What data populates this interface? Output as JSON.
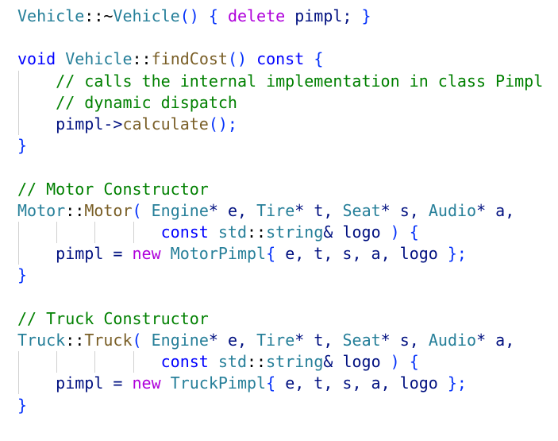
{
  "code_lines": [
    [
      {
        "text": "Vehicle",
        "color": "#267f99"
      },
      {
        "text": "::~",
        "color": "#000000"
      },
      {
        "text": "Vehicle",
        "color": "#267f99"
      },
      {
        "text": "() { ",
        "color": "#0431fa"
      },
      {
        "text": "delete",
        "color": "#af00db"
      },
      {
        "text": " pimpl; ",
        "color": "#001080"
      },
      {
        "text": "}",
        "color": "#0431fa"
      }
    ],
    [],
    [
      {
        "text": "void",
        "color": "#0000ff"
      },
      {
        "text": " ",
        "color": "#000000"
      },
      {
        "text": "Vehicle",
        "color": "#267f99"
      },
      {
        "text": "::",
        "color": "#000000"
      },
      {
        "text": "findCost",
        "color": "#795e26"
      },
      {
        "text": "() ",
        "color": "#0431fa"
      },
      {
        "text": "const",
        "color": "#0000ff"
      },
      {
        "text": " {",
        "color": "#0431fa"
      }
    ],
    [
      {
        "text": "    // calls the internal implementation in class Pimpl",
        "color": "#008000"
      }
    ],
    [
      {
        "text": "    // dynamic dispatch",
        "color": "#008000"
      }
    ],
    [
      {
        "text": "    pimpl->",
        "color": "#001080"
      },
      {
        "text": "calculate",
        "color": "#795e26"
      },
      {
        "text": "();",
        "color": "#0431fa"
      }
    ],
    [
      {
        "text": "}",
        "color": "#0431fa"
      }
    ],
    [],
    [
      {
        "text": "// Motor Constructor",
        "color": "#008000"
      }
    ],
    [
      {
        "text": "Motor",
        "color": "#267f99"
      },
      {
        "text": "::",
        "color": "#000000"
      },
      {
        "text": "Motor",
        "color": "#795e26"
      },
      {
        "text": "( ",
        "color": "#0431fa"
      },
      {
        "text": "Engine",
        "color": "#267f99"
      },
      {
        "text": "* e, ",
        "color": "#001080"
      },
      {
        "text": "Tire",
        "color": "#267f99"
      },
      {
        "text": "* t, ",
        "color": "#001080"
      },
      {
        "text": "Seat",
        "color": "#267f99"
      },
      {
        "text": "* s, ",
        "color": "#001080"
      },
      {
        "text": "Audio",
        "color": "#267f99"
      },
      {
        "text": "* a,",
        "color": "#001080"
      }
    ],
    [
      {
        "text": "               ",
        "color": "#000000"
      },
      {
        "text": "const",
        "color": "#0000ff"
      },
      {
        "text": " ",
        "color": "#000000"
      },
      {
        "text": "std",
        "color": "#267f99"
      },
      {
        "text": "::",
        "color": "#000000"
      },
      {
        "text": "string",
        "color": "#267f99"
      },
      {
        "text": "& logo ",
        "color": "#001080"
      },
      {
        "text": ") {",
        "color": "#0431fa"
      }
    ],
    [
      {
        "text": "    pimpl = ",
        "color": "#001080"
      },
      {
        "text": "new",
        "color": "#af00db"
      },
      {
        "text": " ",
        "color": "#000000"
      },
      {
        "text": "MotorPimpl",
        "color": "#267f99"
      },
      {
        "text": "{ ",
        "color": "#0431fa"
      },
      {
        "text": "e, t, s, a, logo ",
        "color": "#001080"
      },
      {
        "text": "};",
        "color": "#0431fa"
      }
    ],
    [
      {
        "text": "}",
        "color": "#0431fa"
      }
    ],
    [],
    [
      {
        "text": "// Truck Constructor",
        "color": "#008000"
      }
    ],
    [
      {
        "text": "Truck",
        "color": "#267f99"
      },
      {
        "text": "::",
        "color": "#000000"
      },
      {
        "text": "Truck",
        "color": "#795e26"
      },
      {
        "text": "( ",
        "color": "#0431fa"
      },
      {
        "text": "Engine",
        "color": "#267f99"
      },
      {
        "text": "* e, ",
        "color": "#001080"
      },
      {
        "text": "Tire",
        "color": "#267f99"
      },
      {
        "text": "* t, ",
        "color": "#001080"
      },
      {
        "text": "Seat",
        "color": "#267f99"
      },
      {
        "text": "* s, ",
        "color": "#001080"
      },
      {
        "text": "Audio",
        "color": "#267f99"
      },
      {
        "text": "* a,",
        "color": "#001080"
      }
    ],
    [
      {
        "text": "               ",
        "color": "#000000"
      },
      {
        "text": "const",
        "color": "#0000ff"
      },
      {
        "text": " ",
        "color": "#000000"
      },
      {
        "text": "std",
        "color": "#267f99"
      },
      {
        "text": "::",
        "color": "#000000"
      },
      {
        "text": "string",
        "color": "#267f99"
      },
      {
        "text": "& logo ",
        "color": "#001080"
      },
      {
        "text": ") {",
        "color": "#0431fa"
      }
    ],
    [
      {
        "text": "    pimpl = ",
        "color": "#001080"
      },
      {
        "text": "new",
        "color": "#af00db"
      },
      {
        "text": " ",
        "color": "#000000"
      },
      {
        "text": "TruckPimpl",
        "color": "#267f99"
      },
      {
        "text": "{ ",
        "color": "#0431fa"
      },
      {
        "text": "e, t, s, a, logo ",
        "color": "#001080"
      },
      {
        "text": "};",
        "color": "#0431fa"
      }
    ],
    [
      {
        "text": "}",
        "color": "#0431fa"
      }
    ]
  ]
}
